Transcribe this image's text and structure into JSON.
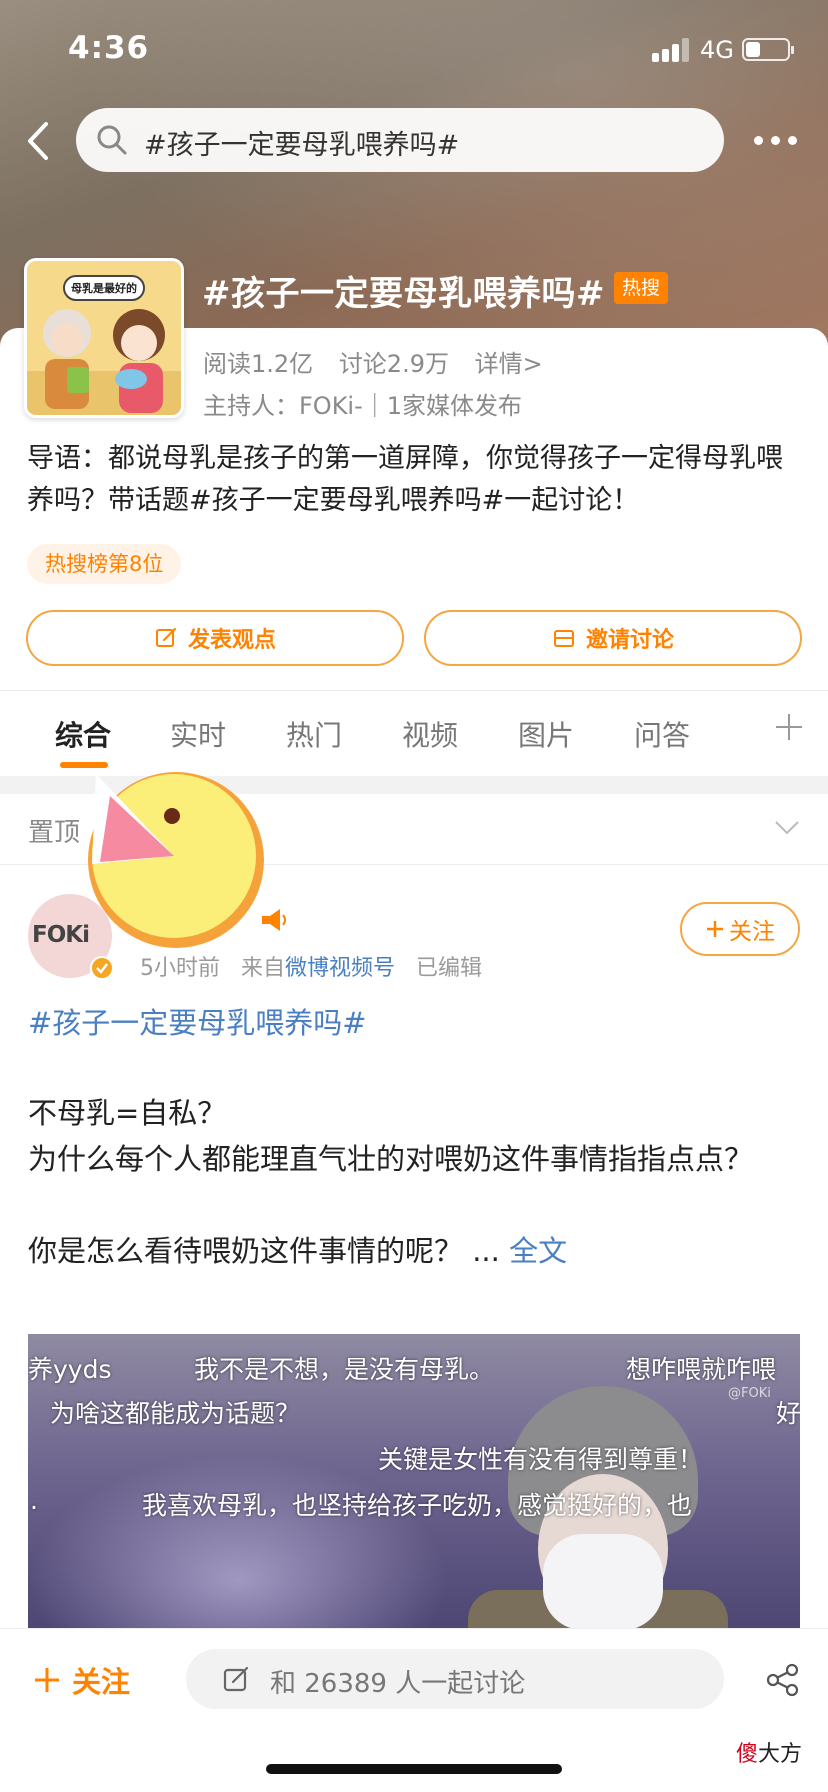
{
  "status_bar": {
    "time": "4:36",
    "network": "4G",
    "battery_level": 0.35
  },
  "search": {
    "query": "#孩子一定要母乳喂养吗#"
  },
  "topic": {
    "thumbnail_caption": "母乳是最好的",
    "title": "#孩子一定要母乳喂养吗#",
    "hot_badge": "热搜",
    "reads": "阅读1.2亿",
    "discussions": "讨论2.9万",
    "details_link": "详情>",
    "host": "主持人：FOKi-｜1家媒体发布",
    "intro": "导语：都说母乳是孩子的第一道屏障，你觉得孩子一定得母乳喂养吗？带话题#孩子一定要母乳喂养吗#一起讨论！",
    "rank": "热搜榜第8位"
  },
  "actions": {
    "post_opinion": "发表观点",
    "invite_discussion": "邀请讨论"
  },
  "tabs": [
    {
      "label": "综合",
      "active": true
    },
    {
      "label": "实时"
    },
    {
      "label": "热门"
    },
    {
      "label": "视频"
    },
    {
      "label": "图片"
    },
    {
      "label": "问答"
    }
  ],
  "pinned": {
    "label": "置顶"
  },
  "post": {
    "avatar_text": "FOKi",
    "time": "5小时前",
    "source_prefix": "来自",
    "source": "微博视频号",
    "edited": "已编辑",
    "follow_label": "关注",
    "hashtag": "#孩子一定要母乳喂养吗#",
    "lines": [
      "不母乳=自私？",
      "为什么每个人都能理直气壮的对喂奶这件事情指指点点？"
    ],
    "question": "你是怎么看待喂奶这件事情的呢？ ...",
    "fulltext": "全文",
    "video_bullets": [
      "养yyds",
      "我不是不想，是没有母乳。",
      "想咋喂就咋喂",
      "为啥这都能成为话题？",
      "关键是女性有没有得到尊重！",
      "我喜欢母乳，也坚持给孩子吃奶，感觉挺好的，也",
      "好",
      "."
    ],
    "video_watermark": "@FOKi"
  },
  "bottom_bar": {
    "follow_label": "关注",
    "discuss_placeholder": "和 26389 人一起讨论"
  },
  "corner_watermark": {
    "red_part": "傻",
    "rest": "大方"
  },
  "colors": {
    "accent": "#ff8200",
    "link": "#4a7fc1",
    "muted": "#8a8a8a"
  }
}
